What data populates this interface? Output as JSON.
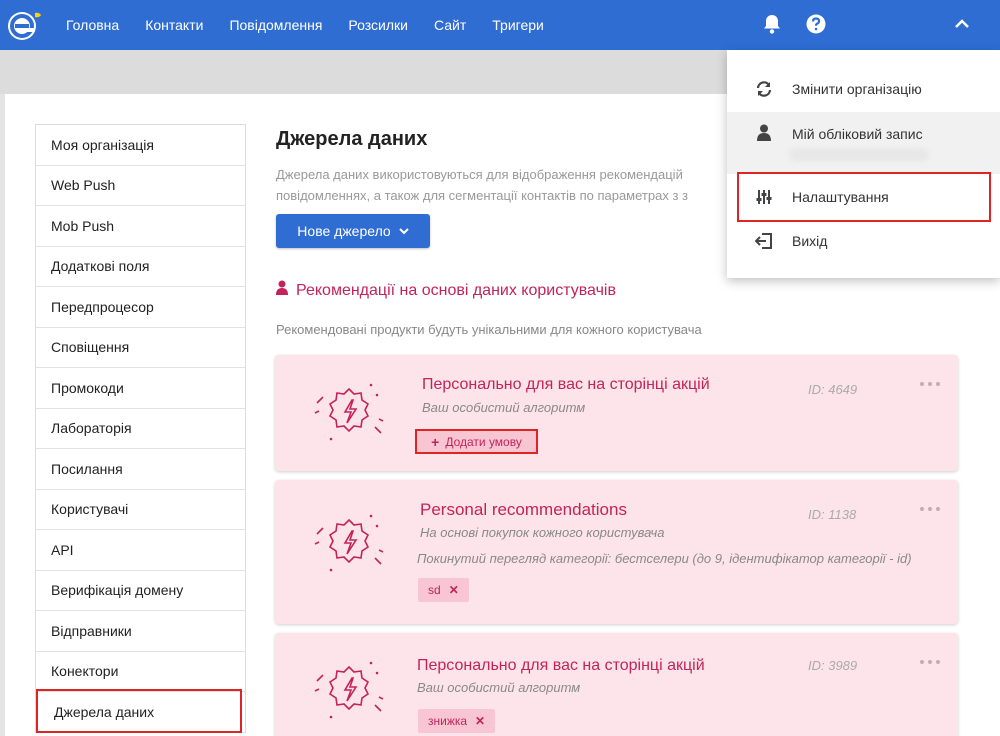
{
  "nav": {
    "items": [
      "Головна",
      "Контакти",
      "Повідомлення",
      "Розсилки",
      "Сайт",
      "Тригери"
    ]
  },
  "sidebar": {
    "items": [
      {
        "label": "Моя організація"
      },
      {
        "label": "Web Push"
      },
      {
        "label": "Mob Push"
      },
      {
        "label": "Додаткові поля"
      },
      {
        "label": "Передпроцесор"
      },
      {
        "label": "Сповіщення"
      },
      {
        "label": "Промокоди"
      },
      {
        "label": "Лабораторія"
      },
      {
        "label": "Посилання"
      },
      {
        "label": "Користувачі"
      },
      {
        "label": "API"
      },
      {
        "label": "Верифікація домену"
      },
      {
        "label": "Відправники"
      },
      {
        "label": "Конектори"
      },
      {
        "label": "Джерела даних"
      }
    ],
    "active": "Джерела даних"
  },
  "main": {
    "title": "Джерела даних",
    "description_line1": "Джерела даних використовуються для відображення рекомендацій",
    "description_line2": "повідомленнях, а також для сегментації контактів по параметрах з з",
    "new_source_label": "Нове джерело",
    "section_title": "Рекомендації на основі даних користувачів",
    "section_desc": "Рекомендовані продукти будуть унікальними для кожного користувача"
  },
  "cards": [
    {
      "title": "Персонально для вас на сторінці акцій",
      "subtitle": "Ваш особистий алгоритм",
      "id": "ID: 4649",
      "add_condition_label": "Додати умову"
    },
    {
      "title": "Personal recommendations",
      "subtitle": "На основі покупок кожного користувача",
      "condition": "Покинутий перегляд категорії: бестселери (до 9, ідентифікатор категорії - id)",
      "id": "ID: 1138",
      "tag": "sd"
    },
    {
      "title": "Персонально для вас на сторінці акцій",
      "subtitle": "Ваш особистий алгоритм",
      "id": "ID: 3989",
      "tag": "знижка"
    }
  ],
  "dropdown": {
    "items": [
      {
        "label": "Змінити організацію",
        "icon": "sync-icon"
      },
      {
        "label": "Мій обліковий запис",
        "icon": "user-icon"
      },
      {
        "label": "Налаштування",
        "icon": "sliders-icon"
      },
      {
        "label": "Вихід",
        "icon": "logout-icon"
      }
    ]
  },
  "colors": {
    "topbar": "#2f6dd3",
    "accent": "#c3235b",
    "card_bg": "#fde4ea",
    "highlight": "#e02424"
  }
}
